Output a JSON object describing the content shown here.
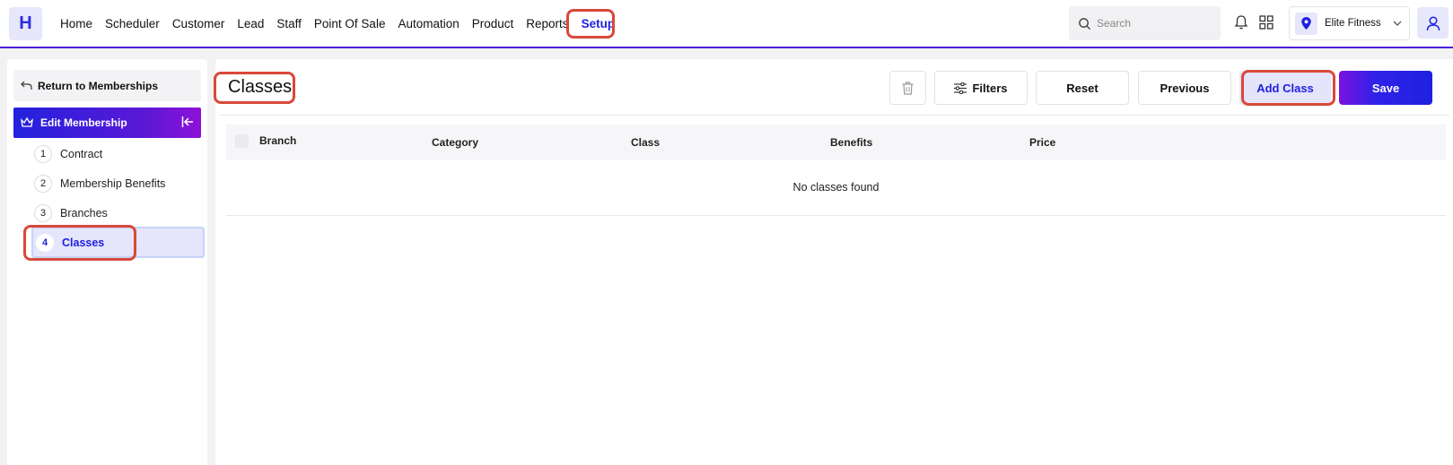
{
  "app": {
    "logo_letter": "H",
    "accent": "#2020e0",
    "highlight": "#d9483a"
  },
  "nav": {
    "items": [
      "Home",
      "Scheduler",
      "Customer",
      "Lead",
      "Staff",
      "Point Of Sale",
      "Automation",
      "Product",
      "Reports",
      "Setup"
    ],
    "active": "Setup"
  },
  "search": {
    "placeholder": "Search"
  },
  "branch": {
    "name": "Elite Fitness"
  },
  "sidebar": {
    "return_label": "Return to Memberships",
    "edit_label": "Edit Membership",
    "steps": [
      {
        "num": "1",
        "label": "Contract"
      },
      {
        "num": "2",
        "label": "Membership Benefits"
      },
      {
        "num": "3",
        "label": "Branches"
      },
      {
        "num": "4",
        "label": "Classes"
      }
    ],
    "active_step": "Classes"
  },
  "main": {
    "title": "Classes",
    "buttons": {
      "filters": "Filters",
      "reset": "Reset",
      "previous": "Previous",
      "add": "Add Class",
      "save": "Save"
    },
    "columns": [
      "Branch",
      "Category",
      "Class",
      "Benefits",
      "Price"
    ],
    "empty_text": "No classes found"
  },
  "icons": [
    "search-icon",
    "bell-icon",
    "apps-grid-icon",
    "location-pin-icon",
    "chevron-down-icon",
    "user-icon",
    "back-arrow-icon",
    "crown-icon",
    "collapse-icon",
    "trash-icon",
    "filter-icon"
  ]
}
